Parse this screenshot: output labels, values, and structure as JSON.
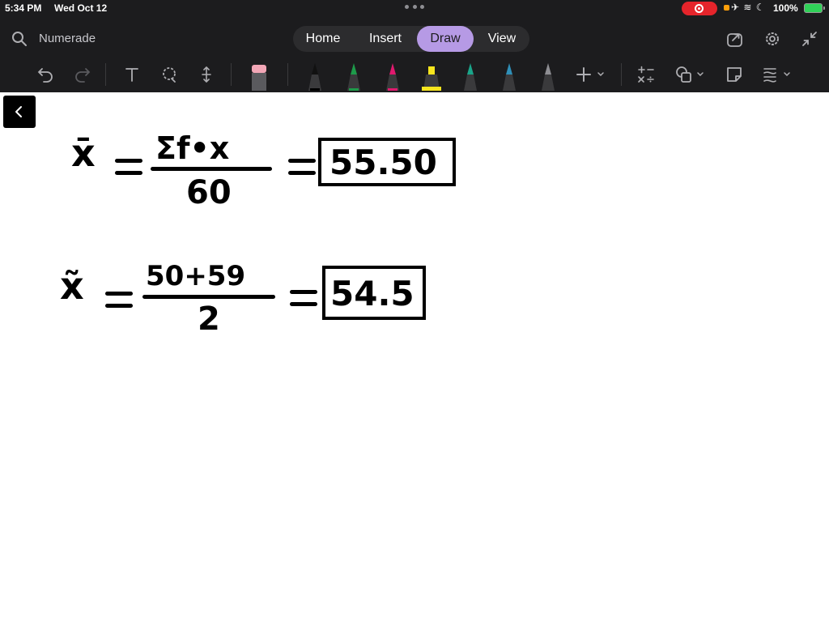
{
  "status_bar": {
    "time": "5:34 PM",
    "date": "Wed Oct 12",
    "battery": "100%"
  },
  "header": {
    "search_label": "Numerade",
    "tabs": [
      {
        "label": "Home",
        "active": false
      },
      {
        "label": "Insert",
        "active": false
      },
      {
        "label": "Draw",
        "active": true
      },
      {
        "label": "View",
        "active": false
      }
    ],
    "accent_color": "#b69ae5"
  },
  "toolbar": {
    "tools": [
      "undo-icon",
      "redo-icon",
      "text-icon",
      "lasso-icon",
      "space-icon",
      "eraser-icon"
    ],
    "pens": [
      {
        "name": "black",
        "color": "#111111"
      },
      {
        "name": "green",
        "color": "#1e9a4a"
      },
      {
        "name": "magenta",
        "color": "#e0196e"
      },
      {
        "name": "yellow-highlighter",
        "color": "#f7e51e"
      },
      {
        "name": "teal",
        "color": "#1aa58a"
      },
      {
        "name": "blue-teal",
        "color": "#2f8fb8"
      },
      {
        "name": "gray",
        "color": "#8e8e93"
      }
    ],
    "extra": [
      "add-icon",
      "math-icon",
      "shapes-icon",
      "sticky-note-icon",
      "ink-style-icon"
    ]
  },
  "canvas": {
    "mean": {
      "symbol": "x̄",
      "numerator": "Σf•x",
      "denominator": "60",
      "result": "55.50"
    },
    "median": {
      "symbol": "x̃",
      "numerator": "50+59",
      "denominator": "2",
      "result": "54.5"
    }
  }
}
